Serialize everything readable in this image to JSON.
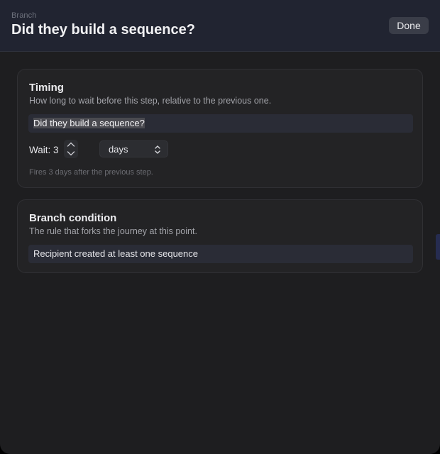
{
  "header": {
    "kicker": "Branch",
    "title": "Did they build a sequence?",
    "done_label": "Done"
  },
  "timing": {
    "title": "Timing",
    "description": "How long to wait before this step, relative to the previous one.",
    "step_name_value": "Did they build a sequence?",
    "wait_label": "Wait: 3",
    "wait_amount": 3,
    "unit_value": "days",
    "hint": "Fires 3 days after the previous step."
  },
  "branch": {
    "title": "Branch condition",
    "description": "The rule that forks the journey at this point.",
    "condition_value": "Recipient created at least one sequence"
  },
  "icons": {
    "stepper": "stepper-chevrons-icon",
    "select": "updown-chevron-icon"
  }
}
